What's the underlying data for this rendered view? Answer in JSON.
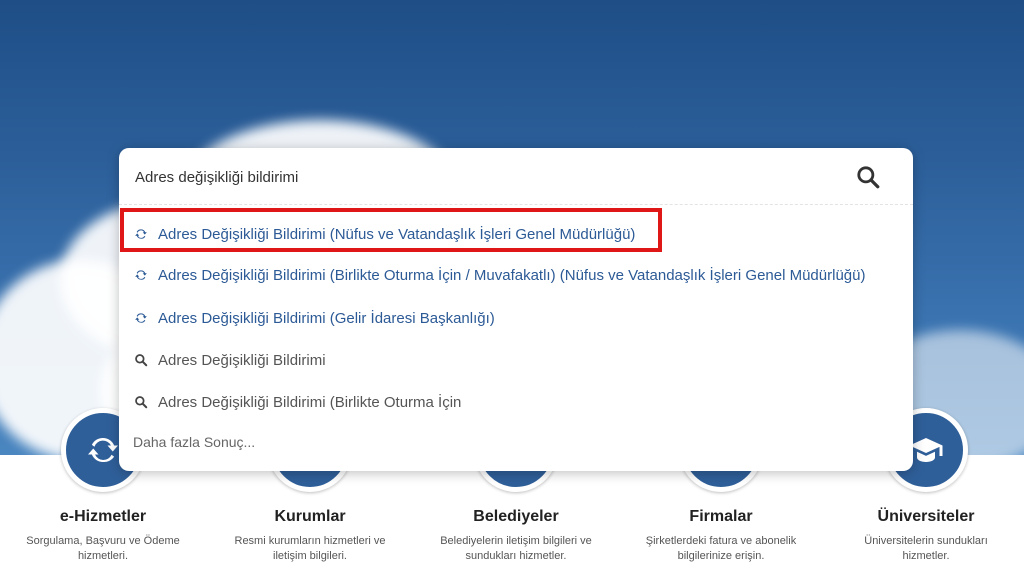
{
  "search": {
    "value": "Adres değişikliği bildirimi",
    "button_icon": "search-icon"
  },
  "suggestions": [
    {
      "type": "service",
      "icon": "refresh-icon",
      "label": "Adres Değişikliği Bildirimi (Nüfus ve Vatandaşlık İşleri Genel Müdürlüğü)",
      "highlighted": true
    },
    {
      "type": "service",
      "icon": "refresh-icon",
      "label": "Adres Değişikliği Bildirimi (Birlikte Oturma İçin / Muvafakatlı) (Nüfus ve Vatandaşlık İşleri Genel Müdürlüğü)"
    },
    {
      "type": "service",
      "icon": "refresh-icon",
      "label": "Adres Değişikliği Bildirimi (Gelir İdaresi Başkanlığı)"
    },
    {
      "type": "search",
      "icon": "search-icon",
      "label": "Adres Değişikliği Bildirimi"
    },
    {
      "type": "search",
      "icon": "search-icon",
      "label": "Adres Değişikliği Bildirimi (Birlikte Oturma İçin"
    }
  ],
  "more_results": "Daha fazla Sonuç...",
  "categories": [
    {
      "title": "e-Hizmetler",
      "desc": "Sorgulama, Başvuru ve Ödeme hizmetleri.",
      "icon": "refresh-icon"
    },
    {
      "title": "Kurumlar",
      "desc": "Resmi kurumların hizmetleri ve iletişim bilgileri.",
      "icon": "building-icon"
    },
    {
      "title": "Belediyeler",
      "desc": "Belediyelerin iletişim bilgileri ve sundukları hizmetler.",
      "icon": "city-icon"
    },
    {
      "title": "Firmalar",
      "desc": "Şirketlerdeki fatura ve abonelik bilgilerinize erişin.",
      "icon": "briefcase-icon"
    },
    {
      "title": "Üniversiteler",
      "desc": "Üniversitelerin sundukları hizmetler.",
      "icon": "graduation-cap-icon"
    }
  ],
  "colors": {
    "accent": "#2f5f99",
    "link": "#2c5a96",
    "highlight": "#e01717"
  }
}
